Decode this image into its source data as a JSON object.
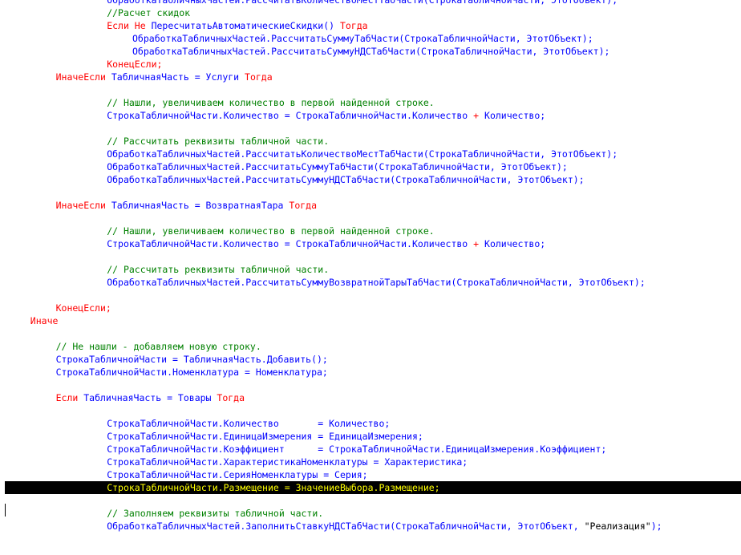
{
  "lines": [
    {
      "t": [
        {
          "c": "n",
          "x": "ОбработкаТабличныхЧастей.РассчитатьКоличествоМестТабЧасти(СтрокаТабличнойЧасти, ЭтотОбъект);"
        }
      ],
      "i": 16
    },
    {
      "t": [
        {
          "c": "cm",
          "x": "//Расчет скидок"
        }
      ],
      "i": 16
    },
    {
      "t": [
        {
          "c": "kw",
          "x": "Если Не "
        },
        {
          "c": "n",
          "x": "ПересчитатьАвтоматическиеСкидки() "
        },
        {
          "c": "kw",
          "x": "Тогда"
        }
      ],
      "i": 16
    },
    {
      "t": [
        {
          "c": "n",
          "x": "ОбработкаТабличныхЧастей.РассчитатьСуммуТабЧасти(СтрокаТабличнойЧасти, ЭтотОбъект);"
        }
      ],
      "i": 20
    },
    {
      "t": [
        {
          "c": "n",
          "x": "ОбработкаТабличныхЧастей.РассчитатьСуммуНДСТабЧасти(СтрокаТабличнойЧасти, ЭтотОбъект);"
        }
      ],
      "i": 20
    },
    {
      "t": [
        {
          "c": "kw",
          "x": "КонецЕсли;"
        }
      ],
      "i": 16
    },
    {
      "t": [
        {
          "c": "kw",
          "x": "ИначеЕсли "
        },
        {
          "c": "n",
          "x": "ТабличнаяЧасть = Услуги "
        },
        {
          "c": "kw",
          "x": "Тогда"
        }
      ],
      "i": 8
    },
    {
      "t": [],
      "i": 0
    },
    {
      "t": [
        {
          "c": "cm",
          "x": "// Нашли, увеличиваем количество в первой найденной строке."
        }
      ],
      "i": 16
    },
    {
      "t": [
        {
          "c": "n",
          "x": "СтрокаТабличнойЧасти.Количество = СтрокаТабличнойЧасти.Количество "
        },
        {
          "c": "kw",
          "x": "+"
        },
        {
          "c": "n",
          "x": " Количество;"
        }
      ],
      "i": 16
    },
    {
      "t": [],
      "i": 0
    },
    {
      "t": [
        {
          "c": "cm",
          "x": "// Рассчитать реквизиты табличной части."
        }
      ],
      "i": 16
    },
    {
      "t": [
        {
          "c": "n",
          "x": "ОбработкаТабличныхЧастей.РассчитатьКоличествоМестТабЧасти(СтрокаТабличнойЧасти, ЭтотОбъект);"
        }
      ],
      "i": 16
    },
    {
      "t": [
        {
          "c": "n",
          "x": "ОбработкаТабличныхЧастей.РассчитатьСуммуТабЧасти(СтрокаТабличнойЧасти, ЭтотОбъект);"
        }
      ],
      "i": 16
    },
    {
      "t": [
        {
          "c": "n",
          "x": "ОбработкаТабличныхЧастей.РассчитатьСуммуНДСТабЧасти(СтрокаТабличнойЧасти, ЭтотОбъект);"
        }
      ],
      "i": 16
    },
    {
      "t": [],
      "i": 0
    },
    {
      "t": [
        {
          "c": "kw",
          "x": "ИначеЕсли "
        },
        {
          "c": "n",
          "x": "ТабличнаяЧасть = ВозвратнаяТара "
        },
        {
          "c": "kw",
          "x": "Тогда"
        }
      ],
      "i": 8
    },
    {
      "t": [],
      "i": 0
    },
    {
      "t": [
        {
          "c": "cm",
          "x": "// Нашли, увеличиваем количество в первой найденной строке."
        }
      ],
      "i": 16
    },
    {
      "t": [
        {
          "c": "n",
          "x": "СтрокаТабличнойЧасти.Количество = СтрокаТабличнойЧасти.Количество "
        },
        {
          "c": "kw",
          "x": "+"
        },
        {
          "c": "n",
          "x": " Количество;"
        }
      ],
      "i": 16
    },
    {
      "t": [],
      "i": 0
    },
    {
      "t": [
        {
          "c": "cm",
          "x": "// Рассчитать реквизиты табличной части."
        }
      ],
      "i": 16
    },
    {
      "t": [
        {
          "c": "n",
          "x": "ОбработкаТабличныхЧастей.РассчитатьСуммуВозвратнойТарыТабЧасти(СтрокаТабличнойЧасти, ЭтотОбъект);"
        }
      ],
      "i": 16
    },
    {
      "t": [],
      "i": 0
    },
    {
      "t": [
        {
          "c": "kw",
          "x": "КонецЕсли;"
        }
      ],
      "i": 8
    },
    {
      "t": [
        {
          "c": "kw",
          "x": "Иначе"
        }
      ],
      "i": 4
    },
    {
      "t": [],
      "i": 0
    },
    {
      "t": [
        {
          "c": "cm",
          "x": "// Не нашли - добавляем новую строку."
        }
      ],
      "i": 8
    },
    {
      "t": [
        {
          "c": "n",
          "x": "СтрокаТабличнойЧасти = ТабличнаяЧасть.Добавить();"
        }
      ],
      "i": 8
    },
    {
      "t": [
        {
          "c": "n",
          "x": "СтрокаТабличнойЧасти.Номенклатура = Номенклатура;"
        }
      ],
      "i": 8
    },
    {
      "t": [],
      "i": 0
    },
    {
      "t": [
        {
          "c": "kw",
          "x": "Если "
        },
        {
          "c": "n",
          "x": "ТабличнаяЧасть = Товары "
        },
        {
          "c": "kw",
          "x": "Тогда"
        }
      ],
      "i": 8
    },
    {
      "t": [],
      "i": 0
    },
    {
      "t": [
        {
          "c": "n",
          "x": "СтрокаТабличнойЧасти.Количество       = Количество;"
        }
      ],
      "i": 16
    },
    {
      "t": [
        {
          "c": "n",
          "x": "СтрокаТабличнойЧасти.ЕдиницаИзмерения = ЕдиницаИзмерения;"
        }
      ],
      "i": 16
    },
    {
      "t": [
        {
          "c": "n",
          "x": "СтрокаТабличнойЧасти.Коэффициент      = СтрокаТабличнойЧасти.ЕдиницаИзмерения.Коэффициент;"
        }
      ],
      "i": 16
    },
    {
      "t": [
        {
          "c": "n",
          "x": "СтрокаТабличнойЧасти.ХарактеристикаНоменклатуры = Характеристика;"
        }
      ],
      "i": 16
    },
    {
      "t": [
        {
          "c": "n",
          "x": "СтрокаТабличнойЧасти.СерияНоменклатуры = Серия;"
        }
      ],
      "i": 16
    },
    {
      "t": [
        {
          "c": "n",
          "x": "СтрокаТабличнойЧасти.Размещение = ЗначениеВыбора.Размещение;"
        }
      ],
      "i": 16,
      "hl": true
    },
    {
      "t": [],
      "i": 0
    },
    {
      "t": [
        {
          "c": "cm",
          "x": "// Заполняем реквизиты табличной части."
        }
      ],
      "i": 16
    },
    {
      "t": [
        {
          "c": "n",
          "x": "ОбработкаТабличныхЧастей.ЗаполнитьСтавкуНДСТабЧасти(СтрокаТабличнойЧасти, ЭтотОбъект, "
        },
        {
          "c": "st",
          "x": "\"Реализация\""
        },
        {
          "c": "n",
          "x": ");"
        }
      ],
      "i": 16
    }
  ],
  "colors": {
    "normal": "#0000ff",
    "keyword": "#ff0000",
    "comment": "#008000",
    "string": "#000000",
    "highlight_bg": "#000000",
    "highlight_fg": "#ffff00"
  }
}
